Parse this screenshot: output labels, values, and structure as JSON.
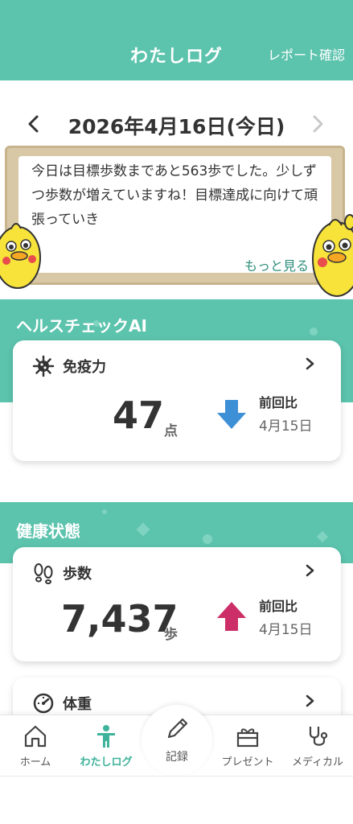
{
  "header": {
    "title": "わたしログ",
    "report_link": "レポート確認"
  },
  "date_nav": {
    "date": "2026年4月16日(今日)",
    "prev_icon": "chevron-left-icon",
    "next_icon": "chevron-right-icon"
  },
  "message": {
    "text": "今日は目標歩数まであと563歩でした。少しずつ歩数が増えていますね！目標達成に向けて頑張っていき",
    "more_label": "もっと見る"
  },
  "health_check": {
    "title": "ヘルスチェックAI",
    "card": {
      "icon": "virus-icon",
      "label": "免疫力",
      "value": "47",
      "unit": "点",
      "compare_label": "前回比",
      "compare_date": "4月15日",
      "trend": "down",
      "trend_color": "#3d8fd6"
    }
  },
  "health_status": {
    "title": "健康状態",
    "steps_card": {
      "icon": "footprints-icon",
      "label": "歩数",
      "value": "7,437",
      "unit": "歩",
      "compare_label": "前回比",
      "compare_date": "4月15日",
      "trend": "up",
      "trend_color": "#cc2f67"
    },
    "weight_card": {
      "icon": "gauge-icon",
      "label": "体重"
    }
  },
  "bottom_nav": {
    "items": [
      {
        "label": "ホーム",
        "icon": "home-icon"
      },
      {
        "label": "わたしログ",
        "icon": "person-icon",
        "active": true
      },
      {
        "label": "記録",
        "icon": "pencil-icon"
      },
      {
        "label": "プレゼント",
        "icon": "gift-icon"
      },
      {
        "label": "メディカル",
        "icon": "stethoscope-icon"
      }
    ]
  },
  "colors": {
    "accent": "#5cc3ad",
    "active_nav": "#3fb39b"
  }
}
